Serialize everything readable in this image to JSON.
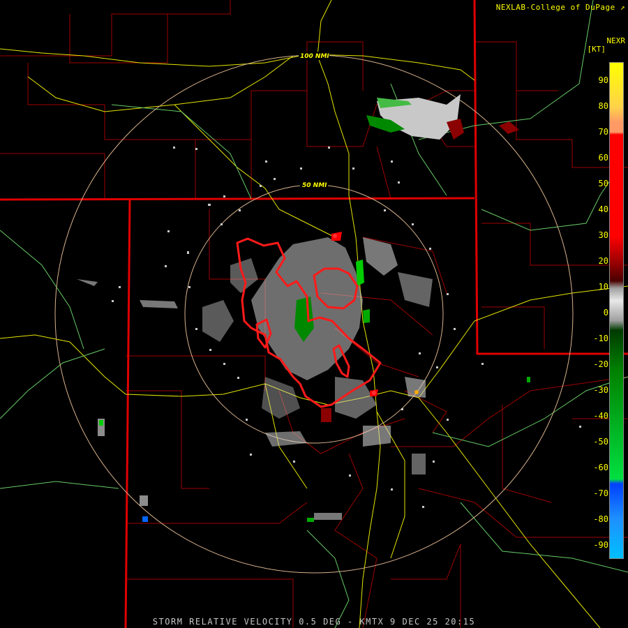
{
  "header": {
    "credit": "NEXLAB-College of DuPage",
    "product_code": "NEXR",
    "units": "[KT]"
  },
  "rings": [
    "100 NMI",
    "50 NMI"
  ],
  "legend": {
    "ticks": [
      "90",
      "80",
      "70",
      "60",
      "50",
      "40",
      "30",
      "20",
      "10",
      "0",
      "-10",
      "-20",
      "-30",
      "-40",
      "-50",
      "-60",
      "-70",
      "-80",
      "-90"
    ],
    "colors": {
      "max": "#ffff00",
      "high": "#ff0000",
      "mid": "#8b0000",
      "zero": "#c8c8c8",
      "neg": "#006400",
      "neg_high": "#00ff00",
      "min": "#00aaff"
    }
  },
  "caption": "STORM RELATIVE VELOCITY 0.5 DEG - KMTX 9 DEC 25 20:15"
}
